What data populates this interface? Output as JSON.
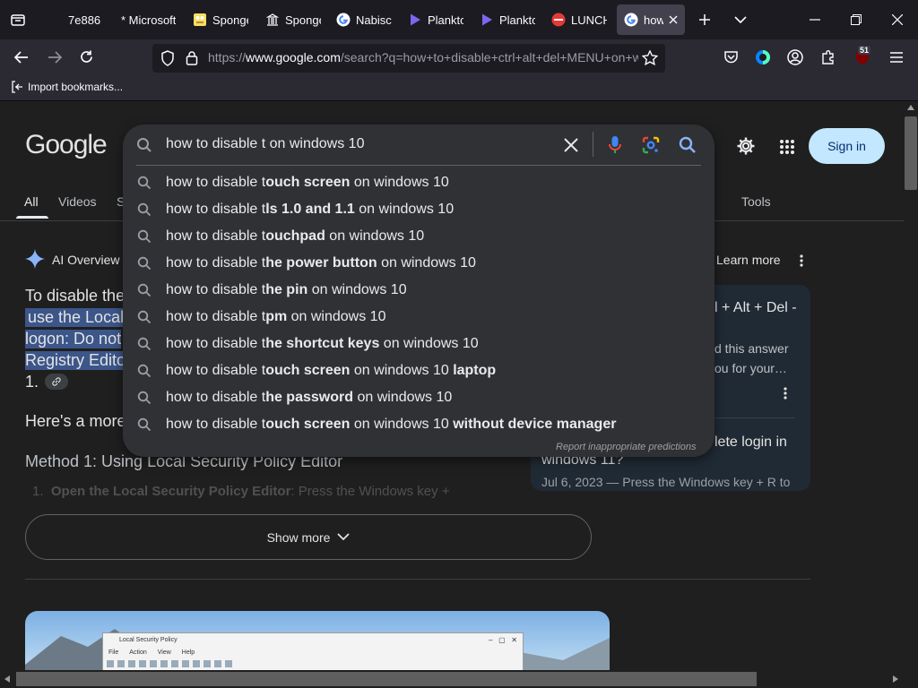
{
  "browser": {
    "tabs": [
      {
        "label": "7e886",
        "favicon": "none"
      },
      {
        "label": "* Microsoft",
        "favicon": "none"
      },
      {
        "label": "Sponge",
        "favicon": "spongebob-icon"
      },
      {
        "label": "Sponge",
        "favicon": "building-icon"
      },
      {
        "label": "Nabisco",
        "favicon": "google-icon"
      },
      {
        "label": "Plankton",
        "favicon": "play-icon"
      },
      {
        "label": "Plankton",
        "favicon": "play-icon"
      },
      {
        "label": "LUNCH",
        "favicon": "lunch-icon"
      },
      {
        "label": "how",
        "favicon": "google-icon"
      }
    ],
    "url_prefix": "https://",
    "url_host": "www.google.com",
    "url_path": "/search?q=how+to+disable+ctrl+alt+del+MENU+on+windows",
    "bookmarks_import_label": "Import bookmarks...",
    "extension_badge": "51"
  },
  "google": {
    "logo": "Google",
    "sign_in": "Sign in",
    "tabs": [
      "All",
      "Videos",
      "S"
    ],
    "tools": "Tools",
    "search_query": "how to disable t on windows 10",
    "suggestions": [
      {
        "prefix": "how to disable t",
        "bold": "ouch screen",
        "suffix": " on windows 10",
        "bold2": ""
      },
      {
        "prefix": "how to disable t",
        "bold": "ls 1.0 and 1.1",
        "suffix": " on windows 10",
        "bold2": ""
      },
      {
        "prefix": "how to disable t",
        "bold": "ouchpad",
        "suffix": " on windows 10",
        "bold2": ""
      },
      {
        "prefix": "how to disable t",
        "bold": "he power button",
        "suffix": " on windows 10",
        "bold2": ""
      },
      {
        "prefix": "how to disable t",
        "bold": "he pin",
        "suffix": " on windows 10",
        "bold2": ""
      },
      {
        "prefix": "how to disable t",
        "bold": "pm",
        "suffix": " on windows 10",
        "bold2": ""
      },
      {
        "prefix": "how to disable t",
        "bold": "he shortcut keys",
        "suffix": " on windows 10",
        "bold2": ""
      },
      {
        "prefix": "how to disable t",
        "bold": "ouch screen",
        "suffix": " on windows 10 ",
        "bold2": "laptop"
      },
      {
        "prefix": "how to disable t",
        "bold": "he password",
        "suffix": " on windows 10",
        "bold2": ""
      },
      {
        "prefix": "how to disable t",
        "bold": "ouch screen",
        "suffix": " on windows 10 ",
        "bold2": "without device manager"
      }
    ],
    "report_label": "Report inappropriate predictions",
    "ai_overview": {
      "label": "AI Overview",
      "learn_more": "Learn more",
      "lines": [
        "To disable the",
        "use the Local",
        "logon: Do not",
        "Registry Edito",
        "1."
      ],
      "heres_more": "Here's a more",
      "method1": "Method 1: Using Local Security Policy Editor",
      "step1_bold": "Open the Local Security Policy Editor",
      "step1_rest": ": Press the Windows key +",
      "show_more": "Show more"
    },
    "right_card": {
      "title_fragment": "l + Alt + Del -",
      "line_a": "d this answer",
      "line_b": "ou for your…",
      "title2_a": "lete login in",
      "title2_b": "windows 11?",
      "snippet": "Jul 6, 2023 — Press the Windows key + R to"
    },
    "video_window_title": "Local Security Policy",
    "video_menu": [
      "File",
      "Action",
      "View",
      "Help"
    ]
  }
}
